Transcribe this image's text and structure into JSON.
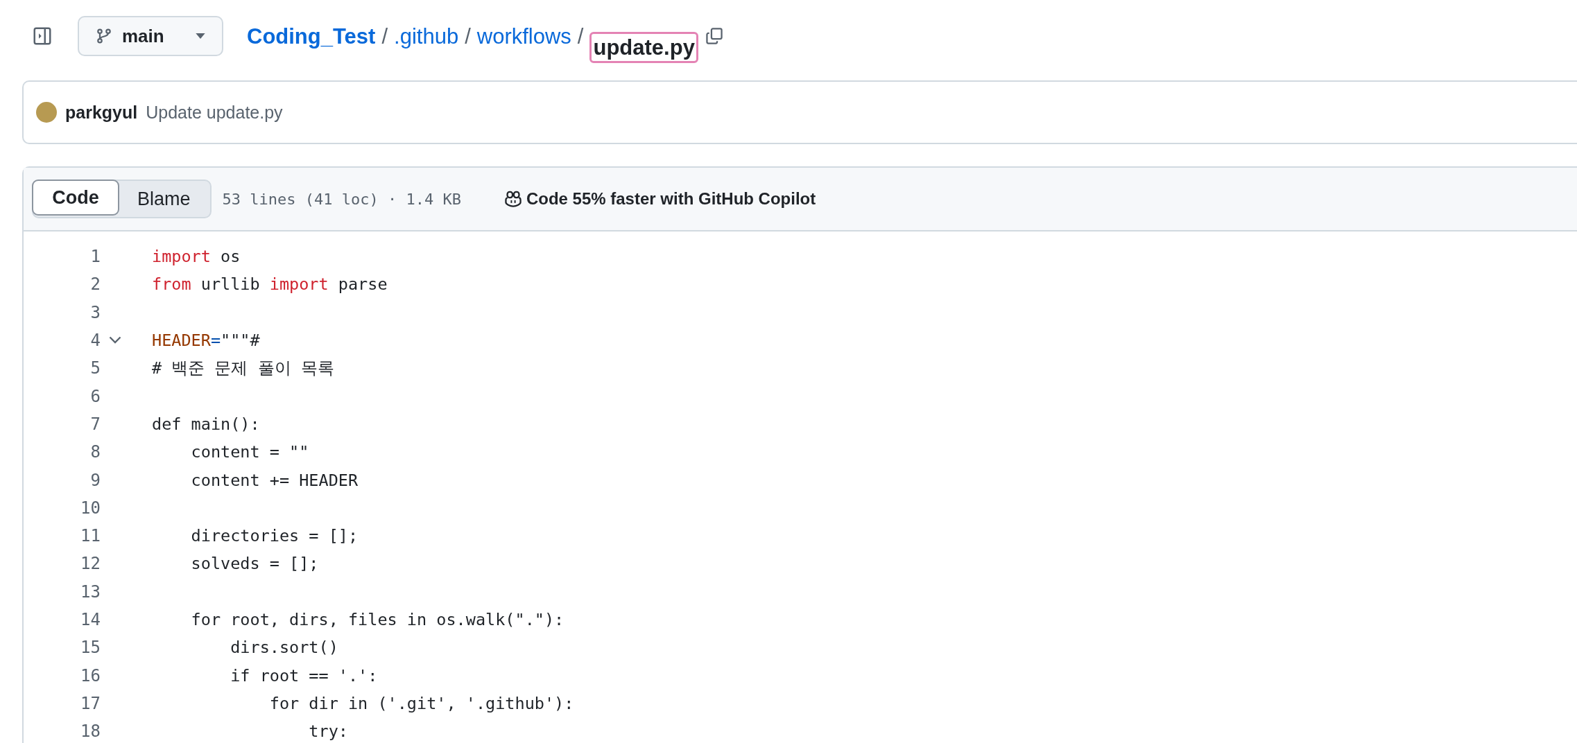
{
  "branch": {
    "label": "main"
  },
  "breadcrumb": [
    {
      "label": "Coding_Test",
      "kind": "repo"
    },
    {
      "label": ".github",
      "kind": "dir"
    },
    {
      "label": "workflows",
      "kind": "dir"
    },
    {
      "label": "update.py",
      "kind": "file"
    }
  ],
  "separator": "/",
  "commit": {
    "author": "parkgyul",
    "message": "Update update.py"
  },
  "tabs": [
    {
      "label": "Code",
      "selected": true
    },
    {
      "label": "Blame",
      "selected": false
    }
  ],
  "file_info": "53 lines (41 loc) · 1.4 KB",
  "copilot": "Code 55% faster with GitHub Copilot",
  "lines": [
    {
      "number": "1",
      "tokens": [
        {
          "kind": "keyword",
          "text": "import"
        },
        {
          "kind": "plain",
          "text": " os"
        }
      ]
    },
    {
      "number": "2",
      "tokens": [
        {
          "kind": "keyword",
          "text": "from"
        },
        {
          "kind": "plain",
          "text": " urllib "
        },
        {
          "kind": "keyword",
          "text": "import"
        },
        {
          "kind": "plain",
          "text": " parse"
        }
      ]
    },
    {
      "number": "3"
    },
    {
      "number": "4",
      "expanded": true,
      "tokens": [
        {
          "kind": "name",
          "text": "HEADER"
        },
        {
          "kind": "operator",
          "text": "="
        },
        {
          "kind": "plain",
          "text": "\"\"\"#"
        }
      ]
    },
    {
      "number": "5",
      "tokens": [
        {
          "kind": "plain",
          "text": "# 백준 문제 풀이 목록"
        }
      ]
    },
    {
      "number": "6"
    },
    {
      "number": "7",
      "tokens": [
        {
          "kind": "plain",
          "text": "def main():"
        }
      ]
    },
    {
      "number": "8",
      "tokens": [
        {
          "kind": "plain",
          "text": "    content = \"\""
        }
      ]
    },
    {
      "number": "9",
      "tokens": [
        {
          "kind": "plain",
          "text": "    content += HEADER"
        }
      ]
    },
    {
      "number": "10"
    },
    {
      "number": "11",
      "tokens": [
        {
          "kind": "plain",
          "text": "    directories = [];"
        }
      ]
    },
    {
      "number": "12",
      "tokens": [
        {
          "kind": "plain",
          "text": "    solveds = [];"
        }
      ]
    },
    {
      "number": "13"
    },
    {
      "number": "14",
      "tokens": [
        {
          "kind": "plain",
          "text": "    for root, dirs, files in os.walk(\".\"):"
        }
      ]
    },
    {
      "number": "15",
      "tokens": [
        {
          "kind": "plain",
          "text": "        dirs.sort()"
        }
      ]
    },
    {
      "number": "16",
      "tokens": [
        {
          "kind": "plain",
          "text": "        if root == '.':"
        }
      ]
    },
    {
      "number": "17",
      "tokens": [
        {
          "kind": "plain",
          "text": "            for dir in ('.git', '.github'):"
        }
      ]
    },
    {
      "number": "18",
      "tokens": [
        {
          "kind": "plain",
          "text": "                try:"
        }
      ]
    }
  ]
}
